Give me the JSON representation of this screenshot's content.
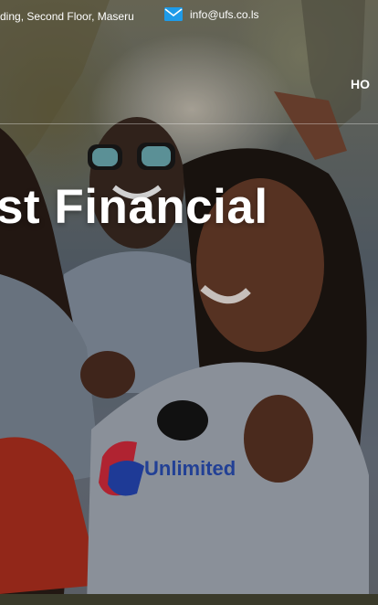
{
  "topbar": {
    "address": "ding, Second Floor, Maseru",
    "email": "info@ufs.co.ls",
    "email_icon": "envelope-icon",
    "icon_color": "#1e9be9"
  },
  "nav": {
    "item_partial": "HO"
  },
  "hero": {
    "headline": "st Financial"
  }
}
